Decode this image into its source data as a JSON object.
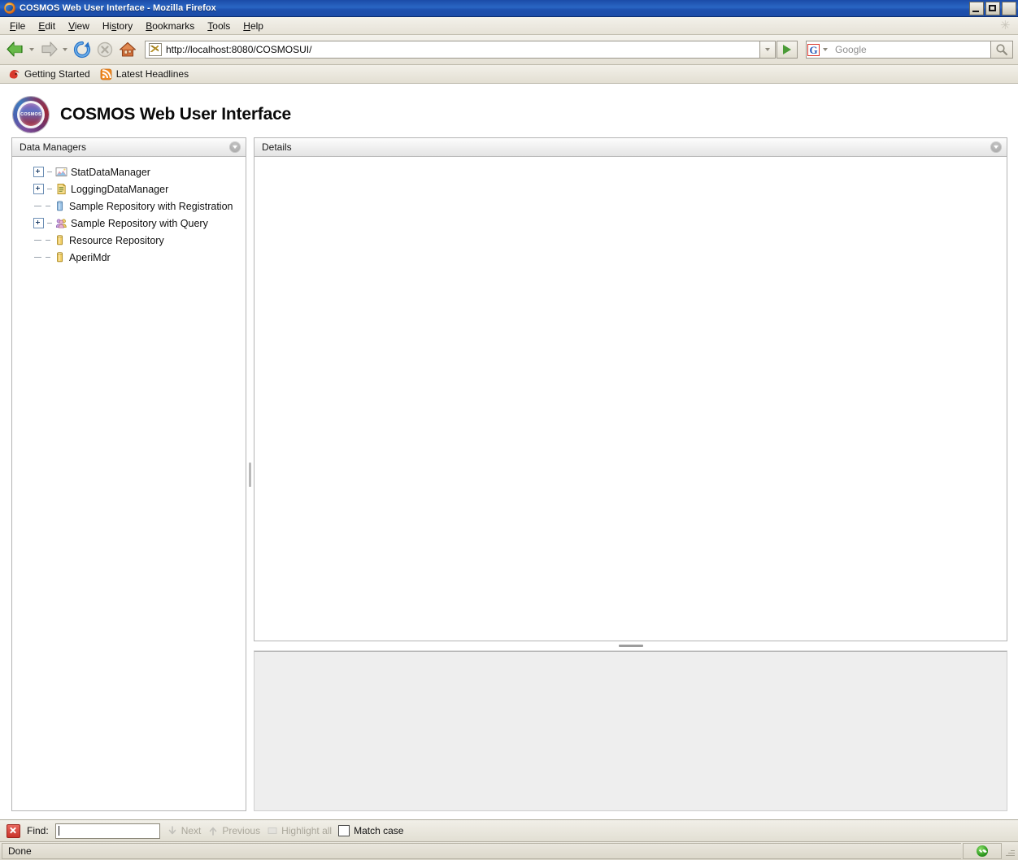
{
  "window": {
    "title": "COSMOS Web User Interface - Mozilla Firefox",
    "app_icon": "firefox-icon",
    "minimize_label": "Minimize",
    "maximize_label": "Maximize",
    "close_label": "Close"
  },
  "menubar": {
    "items": [
      {
        "label": "File",
        "accel": "F"
      },
      {
        "label": "Edit",
        "accel": "E"
      },
      {
        "label": "View",
        "accel": "V"
      },
      {
        "label": "History",
        "accel": "s"
      },
      {
        "label": "Bookmarks",
        "accel": "B"
      },
      {
        "label": "Tools",
        "accel": "T"
      },
      {
        "label": "Help",
        "accel": "H"
      }
    ],
    "gear_icon": "gear-icon"
  },
  "toolbar": {
    "back_label": "Back",
    "forward_label": "Forward",
    "reload_label": "Reload",
    "stop_label": "Stop",
    "home_label": "Home",
    "url": "http://localhost:8080/COSMOSUI/",
    "go_label": "Go",
    "search_engine": "G",
    "search_placeholder": "Google",
    "search_value": "",
    "search_button_label": "Search"
  },
  "bookmarks": [
    {
      "label": "Getting Started",
      "icon": "firefox-bookmark-icon"
    },
    {
      "label": "Latest Headlines",
      "icon": "rss-feed-icon"
    }
  ],
  "page": {
    "app_title": "COSMOS Web User Interface",
    "logo_text": "COSMOS",
    "tree_panel": {
      "title": "Data Managers",
      "collapse_label": "Collapse",
      "items": [
        {
          "label": "StatDataManager",
          "expandable": true,
          "icon": "chart-image-icon"
        },
        {
          "label": "LoggingDataManager",
          "expandable": true,
          "icon": "log-document-icon"
        },
        {
          "label": "Sample Repository with Registration",
          "expandable": false,
          "icon": "blue-database-icon"
        },
        {
          "label": "Sample Repository with Query",
          "expandable": true,
          "icon": "user-group-icon"
        },
        {
          "label": "Resource Repository",
          "expandable": false,
          "icon": "yellow-database-icon"
        },
        {
          "label": "AperiMdr",
          "expandable": false,
          "icon": "yellow-database-icon"
        }
      ]
    },
    "details_panel": {
      "title": "Details",
      "collapse_label": "Collapse",
      "content": ""
    },
    "bottom_panel": {
      "content": ""
    }
  },
  "findbar": {
    "close_label": "Close find bar",
    "label": "Find:",
    "value": "",
    "next_label": "Next",
    "previous_label": "Previous",
    "highlight_label": "Highlight all",
    "match_case_label": "Match case",
    "match_case_checked": false
  },
  "statusbar": {
    "text": "Done",
    "security_icon": "secure-check-icon"
  },
  "colors": {
    "titlebar_blue": "#1b4ca8",
    "chrome_bg": "#e4e0d4",
    "panel_border": "#b4b4b4",
    "bottom_panel_bg": "#eeeeee",
    "accent_green": "#2f9b22",
    "find_close_red": "#c9332a"
  }
}
